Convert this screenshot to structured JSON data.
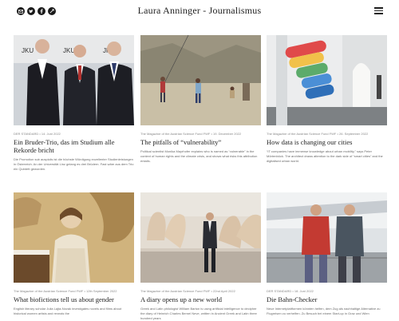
{
  "header": {
    "site_title": "Laura Anninger - Journalismus",
    "social_icons": [
      "email-icon",
      "twitter-icon",
      "facebook-icon",
      "link-icon"
    ],
    "menu_icon": "hamburger-menu-icon"
  },
  "articles": [
    {
      "meta": "DER STANDARD • 14. Juni 2022",
      "title": "Ein Bruder-Trio, das im Studium alle Rekorde bricht",
      "excerpt": "Die Promotion sub auspiciis ist die höchste Würdigung exzellenter Studienleistungen in Österreich. An der Universität Linz gelang es drei Brüdern. Fast wäre aus dem Trio ein Quintett geworden."
    },
    {
      "meta": "The Magazine of the Austrian Science Fund FWF • 19. December 2022",
      "title": "The pitfalls of “vulnerability”",
      "excerpt": "Political scientist Monika Mayrhofer explains who is named as “vulnerable” in the context of human rights and the climate crisis, and shows what risks this attribution entails."
    },
    {
      "meta": "The Magazine of the Austrian Science Fund FWF • 26. September 2022",
      "title": "How data is changing our cities",
      "excerpt": "“IT companies have immense knowledge about urban mobility,” says Peter Mörtenböck. The architect draws attention to the dark side of “smart cities” and the digitalised urban world."
    },
    {
      "meta": "The Magazine of the Austrian Science Fund FWF • 12th September 2022",
      "title": "What biofictions tell us about gender",
      "excerpt": "English literary scholar Julia Lajta-Novak investigates novels and films about historical women artists and reveals the"
    },
    {
      "meta": "The Magazine of the Austrian Science Fund FWF • 22nd April 2022",
      "title": "A diary opens up a new world",
      "excerpt": "Greek and Latin philologist William Barton is using artificial intelligence to decipher the diary of Heinrich Charles Bernel Neve, written in Ancient Greek and Latin three hundred years"
    },
    {
      "meta": "DER STANDARD • 18. Juni 2022",
      "title": "Die Bahn-Checker",
      "excerpt": "Neue Internetplattformen könnten helfen, dem Zug als nachhaltige Alternative zu Flugreisen zu verhelfen. Zu Besuch bei einem Start-up in Graz und Wien"
    }
  ]
}
